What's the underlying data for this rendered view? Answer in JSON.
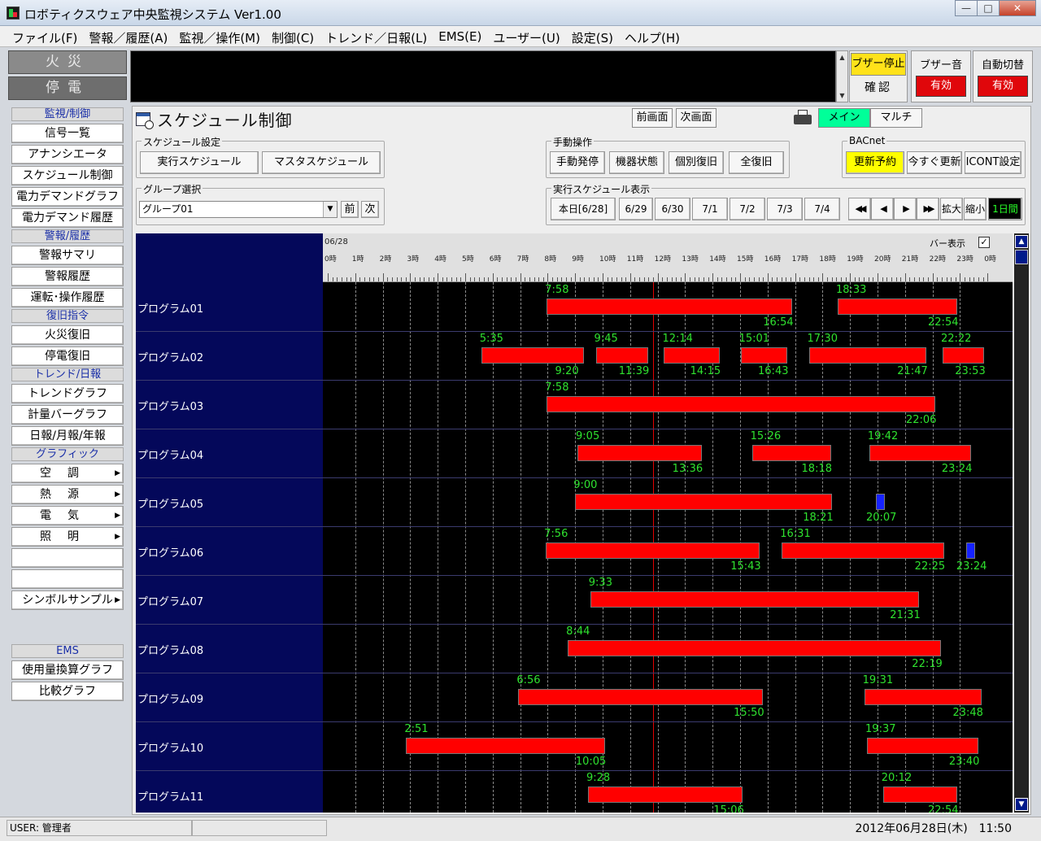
{
  "window": {
    "title": "ロボティクスウェア中央監視システム Ver1.00"
  },
  "menu": [
    "ファイル(F)",
    "警報／履歴(A)",
    "監視／操作(M)",
    "制御(C)",
    "トレンド／日報(L)",
    "EMS(E)",
    "ユーザー(U)",
    "設定(S)",
    "ヘルプ(H)"
  ],
  "alarm": {
    "fire": "火災",
    "outage": "停電",
    "buzzer_stop": "ブザー停止",
    "confirm": "確認",
    "buzzer_sound": {
      "label": "ブザー音",
      "value": "有効"
    },
    "auto_switch": {
      "label": "自動切替",
      "value": "有効"
    }
  },
  "sidebar": {
    "sections": [
      {
        "title": "監視/制御",
        "items": [
          "信号一覧",
          "アナンシエータ",
          "スケジュール制御",
          "電力デマンドグラフ",
          "電力デマンド履歴"
        ]
      },
      {
        "title": "警報/履歴",
        "items": [
          "警報サマリ",
          "警報履歴",
          "運転･操作履歴"
        ]
      },
      {
        "title": "復旧指令",
        "items": [
          "火災復旧",
          "停電復旧"
        ]
      },
      {
        "title": "トレンド/日報",
        "items": [
          "トレンドグラフ",
          "計量バーグラフ",
          "日報/月報/年報"
        ]
      }
    ],
    "graphics_title": "グラフィック",
    "graphics_items": [
      "空調",
      "熱源",
      "電気",
      "照明"
    ],
    "symbol_sample": "シンボルサンプル",
    "ems_title": "EMS",
    "ems_items": [
      "使用量換算グラフ",
      "比較グラフ"
    ]
  },
  "page": {
    "title": "スケジュール制御",
    "prev_screen": "前画面",
    "next_screen": "次画面",
    "view_main": "メイン",
    "view_multi": "マルチ"
  },
  "schedule_settings": {
    "label": "スケジュール設定",
    "exec": "実行スケジュール",
    "master": "マスタスケジュール"
  },
  "manual": {
    "label": "手動操作",
    "buttons": [
      "手動発停",
      "機器状態",
      "個別復旧",
      "全復旧"
    ]
  },
  "bacnet": {
    "label": "BACnet",
    "reserve": "更新予約",
    "now": "今すぐ更新",
    "icont": "ICONT設定"
  },
  "group": {
    "label": "グループ選択",
    "value": "グループ01",
    "prev": "前",
    "next": "次"
  },
  "exec_display": {
    "label": "実行スケジュール表示",
    "days": [
      "本日[6/28]",
      "6/29",
      "6/30",
      "7/1",
      "7/2",
      "7/3",
      "7/4"
    ],
    "zoom_in": "拡大",
    "zoom_out": "縮小",
    "span": "1日間"
  },
  "chart_data": {
    "date": "06/28",
    "bar_display": "バー表示",
    "hour_labels": [
      "0時",
      "1時",
      "2時",
      "3時",
      "4時",
      "5時",
      "6時",
      "7時",
      "8時",
      "9時",
      "10時",
      "11時",
      "12時",
      "13時",
      "14時",
      "15時",
      "16時",
      "17時",
      "18時",
      "19時",
      "20時",
      "21時",
      "22時",
      "23時",
      "0時"
    ],
    "current_time": "11:50",
    "programs": [
      {
        "name": "プログラム01",
        "bars": [
          {
            "start": "7:58",
            "end": "16:54"
          },
          {
            "start": "18:33",
            "end": "22:54"
          }
        ]
      },
      {
        "name": "プログラム02",
        "bars": [
          {
            "start": "5:35",
            "end": "9:20"
          },
          {
            "start": "9:45",
            "end": "11:39"
          },
          {
            "start": "12:14",
            "end": "14:15"
          },
          {
            "start": "15:01",
            "end": "16:43"
          },
          {
            "start": "17:30",
            "end": "21:47"
          },
          {
            "start": "22:22",
            "end": "23:53"
          }
        ]
      },
      {
        "name": "プログラム03",
        "bars": [
          {
            "start": "7:58",
            "end": "22:06"
          }
        ]
      },
      {
        "name": "プログラム04",
        "bars": [
          {
            "start": "9:05",
            "end": "13:36"
          },
          {
            "start": "15:26",
            "end": "18:18"
          },
          {
            "start": "19:42",
            "end": "23:24"
          }
        ]
      },
      {
        "name": "プログラム05",
        "bars": [
          {
            "start": "9:00",
            "end": "18:21"
          },
          {
            "start": "",
            "end": "20:07",
            "at": "20:07",
            "kind": "blue"
          }
        ]
      },
      {
        "name": "プログラム06",
        "bars": [
          {
            "start": "7:56",
            "end": "15:43"
          },
          {
            "start": "16:31",
            "end": "22:25"
          },
          {
            "start": "",
            "end": "23:24",
            "at": "23:24",
            "kind": "blue"
          }
        ]
      },
      {
        "name": "プログラム07",
        "bars": [
          {
            "start": "9:33",
            "end": "21:31"
          }
        ]
      },
      {
        "name": "プログラム08",
        "bars": [
          {
            "start": "8:44",
            "end": "22:19"
          }
        ]
      },
      {
        "name": "プログラム09",
        "bars": [
          {
            "start": "6:56",
            "end": "15:50"
          },
          {
            "start": "19:31",
            "end": "23:48"
          }
        ]
      },
      {
        "name": "プログラム10",
        "bars": [
          {
            "start": "2:51",
            "end": "10:05"
          },
          {
            "start": "19:37",
            "end": "23:40"
          }
        ]
      },
      {
        "name": "プログラム11",
        "bars": [
          {
            "start": "9:28",
            "end": "15:06"
          },
          {
            "start": "20:12",
            "end": "22:54"
          }
        ]
      }
    ]
  },
  "status": {
    "user": "USER: 管理者",
    "datetime": "2012年06月28日(木)　11:50"
  }
}
